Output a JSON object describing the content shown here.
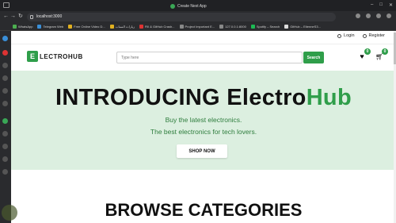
{
  "browser": {
    "window_title": "Create Next App",
    "url": "localhost:3000",
    "bookmarks": [
      "WhatsApp",
      "Telegram Web",
      "Free Online Video D...",
      "زيارات السناب",
      "Fill & GitHub Crash...",
      "Project Important E...",
      "127.0.0.1:8000",
      "Spotify – Search",
      "GitHub – EtienneS3..."
    ]
  },
  "site": {
    "logo_letter": "E",
    "logo_text": "LECTROHUB",
    "top_links": {
      "login": "Login",
      "register": "Register"
    },
    "search": {
      "placeholder": "Type here",
      "button": "Search"
    },
    "wishlist_count": "0",
    "cart_count": "0",
    "hero": {
      "title_part1": "INTRODUCING Electro",
      "title_part2": "Hub",
      "line1": "Buy the latest electronics.",
      "line2": "The best electronics for tech lovers.",
      "cta": "SHOP NOW"
    },
    "categories_title": "BROWSE CATEGORIES"
  },
  "colors": {
    "brand_green": "#2f9e4a",
    "hero_bg": "#dcefe0"
  }
}
